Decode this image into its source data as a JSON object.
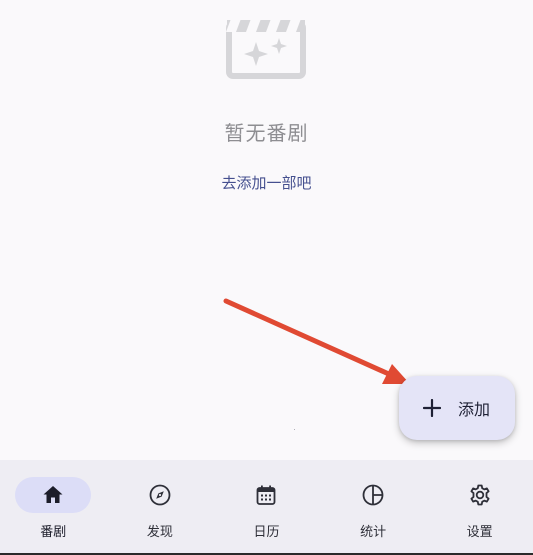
{
  "empty_state": {
    "icon": "movie-clapper-sparkle-icon",
    "title": "暂无番剧",
    "link": "去添加一部吧"
  },
  "annotation": {
    "icon": "red-arrow-icon",
    "color": "#E04A33"
  },
  "fab": {
    "icon": "plus-icon",
    "label": "添加"
  },
  "bottom_nav": {
    "active_index": 0,
    "items": [
      {
        "icon": "home-icon",
        "label": "番剧"
      },
      {
        "icon": "compass-icon",
        "label": "发现"
      },
      {
        "icon": "calendar-icon",
        "label": "日历"
      },
      {
        "icon": "pie-chart-icon",
        "label": "统计"
      },
      {
        "icon": "gear-icon",
        "label": "设置"
      }
    ]
  },
  "colors": {
    "background": "#FAF9FB",
    "nav_background": "#EEEDF3",
    "active_pill": "#DCDDF7",
    "fab_background": "#E4E4F7",
    "link": "#45508F",
    "muted_text": "#8E8E92"
  }
}
